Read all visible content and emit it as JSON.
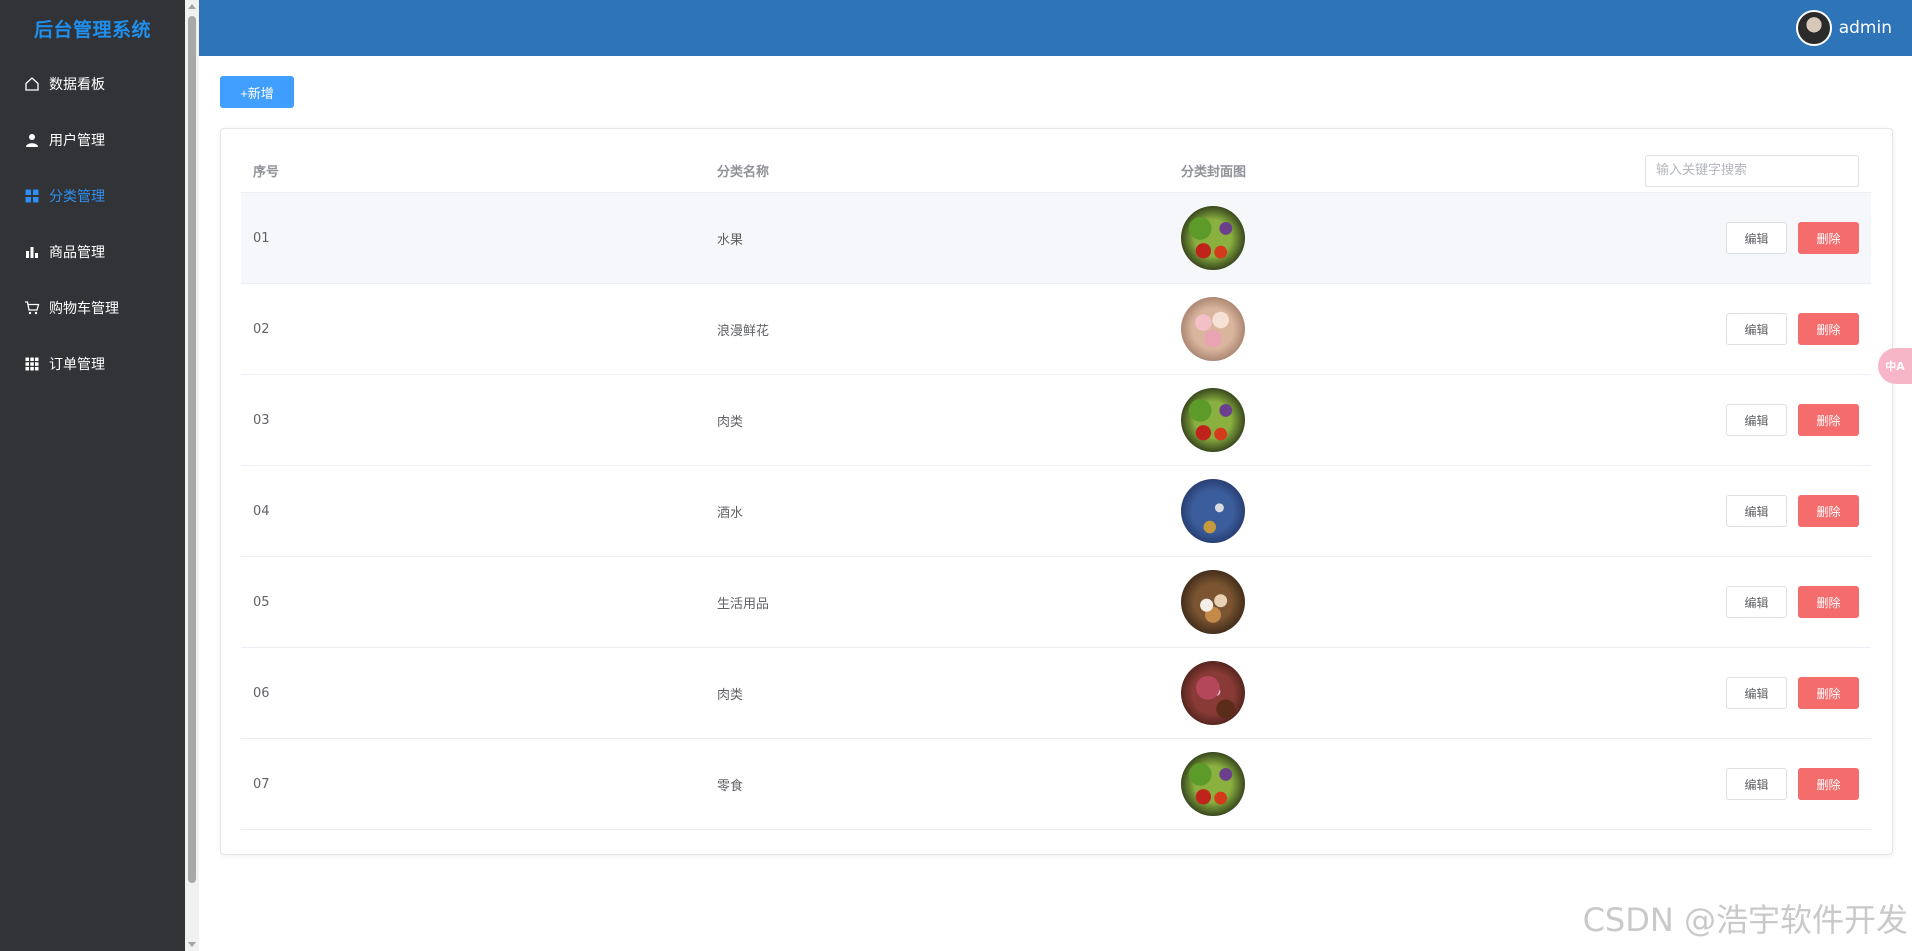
{
  "app": {
    "title": "后台管理系统"
  },
  "sidebar": {
    "items": [
      {
        "label": "数据看板",
        "icon": "home-icon",
        "active": false
      },
      {
        "label": "用户管理",
        "icon": "user-icon",
        "active": false
      },
      {
        "label": "分类管理",
        "icon": "grid-icon",
        "active": true
      },
      {
        "label": "商品管理",
        "icon": "bar-chart-icon",
        "active": false
      },
      {
        "label": "购物车管理",
        "icon": "cart-icon",
        "active": false
      },
      {
        "label": "订单管理",
        "icon": "apps-icon",
        "active": false
      }
    ]
  },
  "header": {
    "username": "admin"
  },
  "toolbar": {
    "add_label": "+新增"
  },
  "table": {
    "columns": [
      "序号",
      "分类名称",
      "分类封面图"
    ],
    "search_placeholder": "输入关键字搜索",
    "rows": [
      {
        "index": "01",
        "name": "水果",
        "cover": "vegetables-image"
      },
      {
        "index": "02",
        "name": "浪漫鲜花",
        "cover": "flowers-image"
      },
      {
        "index": "03",
        "name": "肉类",
        "cover": "vegetables-image"
      },
      {
        "index": "04",
        "name": "酒水",
        "cover": "drinks-image"
      },
      {
        "index": "05",
        "name": "生活用品",
        "cover": "eggs-image"
      },
      {
        "index": "06",
        "name": "肉类",
        "cover": "meat-image"
      },
      {
        "index": "07",
        "name": "零食",
        "cover": "vegetables-image"
      }
    ],
    "edit_label": "编辑",
    "delete_label": "删除"
  },
  "floating": {
    "translate_label": "中A"
  },
  "watermark": "CSDN @浩宇软件开发",
  "colors": {
    "sidebar_bg": "#313336",
    "header_bg": "#2e74b9",
    "accent": "#409eff",
    "active_menu": "#2f8ff0",
    "danger": "#f56c6c"
  }
}
